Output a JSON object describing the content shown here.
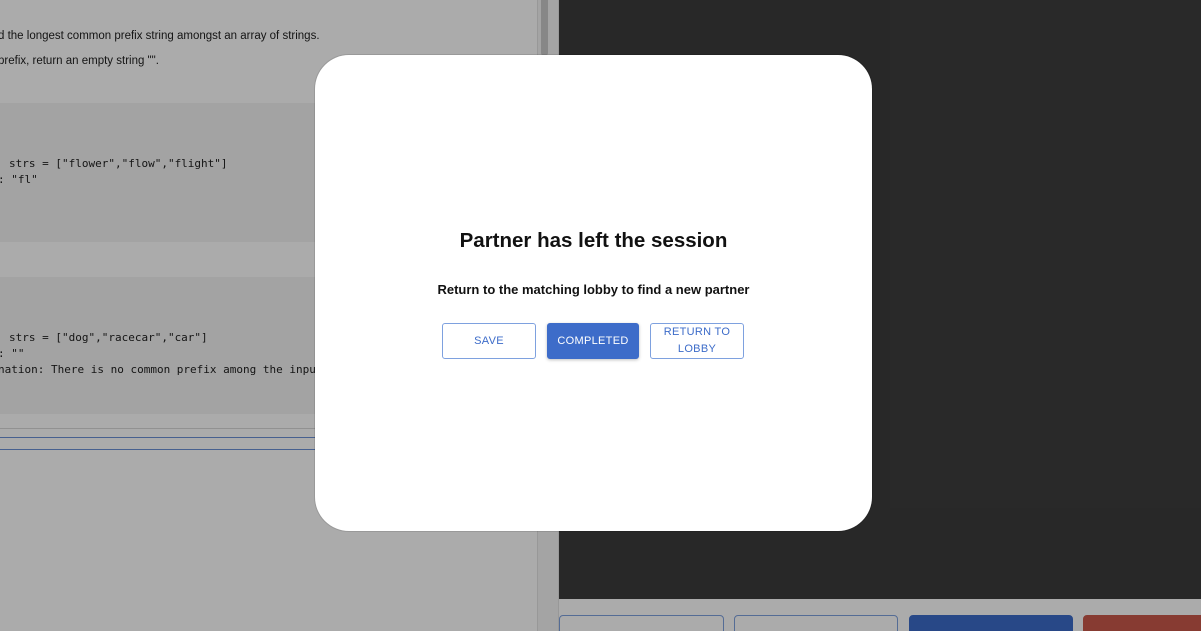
{
  "problem": {
    "statement_line1": "d the longest common prefix string amongst an array of strings.",
    "statement_line2": "prefix, return an empty string \"\".",
    "example1": {
      "input": "strs = [\"flower\",\"flow\",\"flight\"]",
      "output": ": \"fl\""
    },
    "example2": {
      "input": "strs = [\"dog\",\"racecar\",\"car\"]",
      "output": ": \"\"",
      "explanation": "nation: There is no common prefix among the input"
    }
  },
  "modal": {
    "title": "Partner has left the session",
    "subtitle": "Return to the matching lobby to find a new partner",
    "buttons": {
      "save": "Save",
      "completed": "Completed",
      "return_to_lobby": "Return to Lobby"
    }
  },
  "colors": {
    "primary": "#3d6cc9",
    "danger": "#c9594b",
    "editor_bg": "#3d3d3d"
  }
}
